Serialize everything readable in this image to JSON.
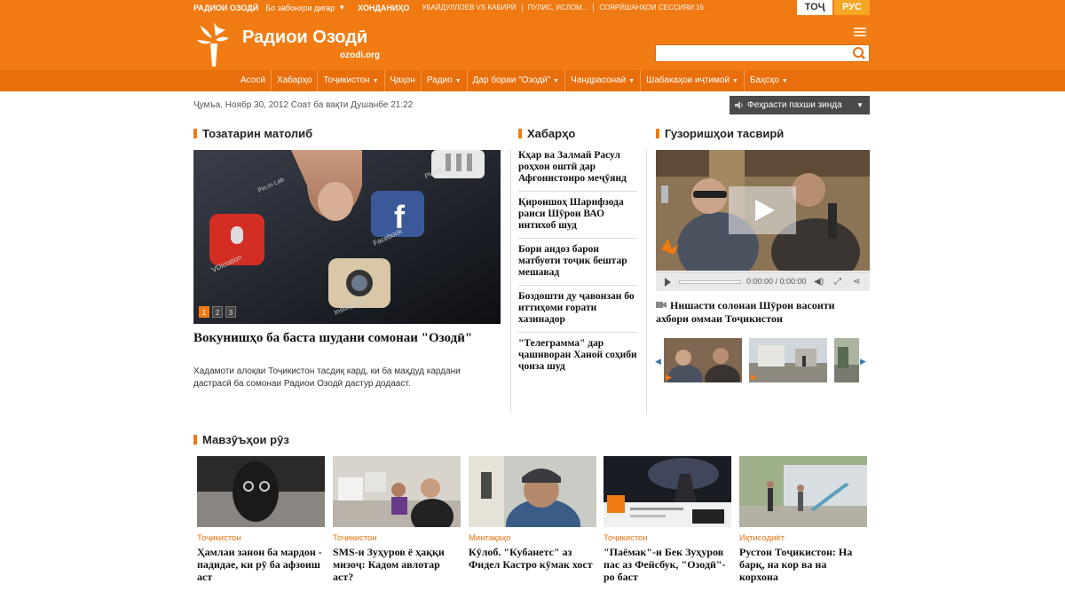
{
  "topbar": {
    "brand": "РАДИОИ ОЗОДӢ",
    "other_sites": "Бо забонҳои дигар",
    "trending_label": "ХОНДАНИҲО",
    "links": [
      "УБАЙДУЛЛОЕВ VS КАБИРӢ",
      "ПУЛИС, ИСЛОМ...",
      "СОЯРӢШАНҲОИ СЕССИЯИ 16"
    ],
    "lang_tj": "ТОҶ",
    "lang_ru": "РУС"
  },
  "header": {
    "logo_title": "Радиои Озодӣ",
    "logo_site": "ozodi.org"
  },
  "nav": {
    "items": [
      {
        "label": "Асосӣ",
        "dropdown": false
      },
      {
        "label": "Хабарҳо",
        "dropdown": false
      },
      {
        "label": "Тоҷикистон",
        "dropdown": true
      },
      {
        "label": "Ҷаҳон",
        "dropdown": false
      },
      {
        "label": "Радио",
        "dropdown": true
      },
      {
        "label": "Дар бораи \"Озодӣ\"",
        "dropdown": true
      },
      {
        "label": "Чандрасонаӣ",
        "dropdown": true
      },
      {
        "label": "Шабакаҳои иҷтимоӣ",
        "dropdown": true
      },
      {
        "label": "Баҳсҳо",
        "dropdown": true
      }
    ]
  },
  "datebar": {
    "date": "Ҷумъа, Ноябр 30, 2012 Соат ба вақти Душанбе 21:22",
    "live_button": "Феҳрасти пахши зинда"
  },
  "sections": {
    "latest": "Тозатарин матолиб",
    "news": "Хабарҳо",
    "photos": "Гузоришҳои тасвирӣ",
    "topics": "Мавзӯъҳои рӯз"
  },
  "lead": {
    "pager": [
      "1",
      "2",
      "3"
    ],
    "image_labels": {
      "vdictation": "VDictation",
      "facebook": "Facebook",
      "instagram": "Instagram",
      "pinlab": "Pin.In Lab",
      "plume": "Plume"
    },
    "headline": "Вокунишҳо ба баста шудани сомонаи \"Озодӣ\"",
    "description": "Хадамоти алоқаи Тоҷикистон тасдиқ кард, ки ба маҳдуд кардани дастрасӣ ба сомонаи Радиои Озодӣ дастур додааст."
  },
  "news": [
    "Кҳар ва Залмай Расул роҳхон оштӣ дар Афғонистонро меҷӯянд",
    "Қироншоҳ Шарифзода раиси Шӯрои ВАО интихоб шуд",
    "Бори андоз барон матбуоти тоҷик бештар мешавад",
    "Боздошти ду ҷавонзан бо иттиҳоми ғорати хазинадор",
    "\"Телеграмма\" дар ҷашнворан Ханой соҳиби ҷонза шуд"
  ],
  "video": {
    "time": "0:00:00 / 0:00:00",
    "caption": "Нишасти солонаи Шӯрои васоити ахбори оммаи Тоҷикистон"
  },
  "topics": [
    {
      "category": "Тоҷикистон",
      "headline": "Ҳамлаи занон ба мардон - падидае, ки рӯ ба афзоиш аст"
    },
    {
      "category": "Тоҷикистон",
      "headline": "SMS-и Зуҳуров ё ҳаққи мизоҷ: Кадом авлотар аст?"
    },
    {
      "category": "Минтақаҳо",
      "headline": "Кӯлоб. \"Кубанетс\" аз Фидел Кастро кӯмак хост"
    },
    {
      "category": "Тоҷикистон",
      "headline": "\"Паёмак\"-и Бек Зуҳуров пас аз Фейсбук, \"Озодӣ\"-ро баст"
    },
    {
      "category": "Иқтисодиёт",
      "headline": "Рустон Тоҷикистон: На барқ, на кор ва на корхона"
    }
  ],
  "colors": {
    "brand": "#f07a12",
    "nav": "#e86f0c",
    "category": "#e8710e"
  },
  "icons": [
    "flame-logo-icon",
    "menu-icon",
    "search-icon",
    "speaker-icon",
    "play-icon",
    "volume-icon",
    "fullscreen-icon",
    "share-icon",
    "camera-icon",
    "arrow-left-icon",
    "arrow-right-icon"
  ]
}
